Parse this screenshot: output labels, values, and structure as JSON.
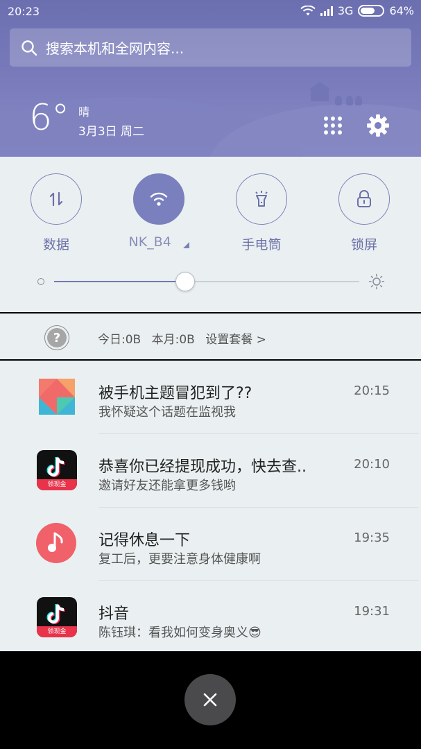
{
  "status_bar": {
    "time": "20:23",
    "network": "3G",
    "battery": "64%",
    "battery_level": 0.64
  },
  "search": {
    "placeholder": "搜索本机和全网内容..."
  },
  "weather": {
    "temperature": "6°",
    "condition": "晴",
    "date": "3月3日 周二"
  },
  "quick_settings": {
    "toggles": [
      {
        "label": "数据",
        "icon": "data-transfer-icon",
        "active": false
      },
      {
        "label": "NK_B4",
        "icon": "wifi-icon",
        "active": true
      },
      {
        "label": "手电筒",
        "icon": "flashlight-icon",
        "active": false
      },
      {
        "label": "锁屏",
        "icon": "lock-icon",
        "active": false
      }
    ],
    "brightness_level": 0.43
  },
  "data_usage": {
    "today": "今日:0B",
    "month": "本月:0B",
    "setup_link": "设置套餐 >"
  },
  "notifications": [
    {
      "app_icon": "miui-theme-icon",
      "title": "被手机主题冒犯到了??",
      "body": "我怀疑这个话题在监视我",
      "time": "20:15"
    },
    {
      "app_icon": "tiktok-icon",
      "badge": "领现金",
      "title": "恭喜你已经提现成功，快去查..",
      "body": "邀请好友还能拿更多钱哟",
      "time": "20:10"
    },
    {
      "app_icon": "music-icon",
      "title": "记得休息一下",
      "body": "复工后，更要注意身体健康啊",
      "time": "19:35"
    },
    {
      "app_icon": "tiktok-icon",
      "badge": "领现金",
      "title": "抖音",
      "body": "陈钰琪：看我如何变身奥义😎",
      "time": "19:31"
    }
  ],
  "colors": {
    "header": "#7a7cbc",
    "accent": "#7a7fbd",
    "panel": "#eaf0f1",
    "tiktok_badge": "#e8334b",
    "music": "#f0616a"
  }
}
